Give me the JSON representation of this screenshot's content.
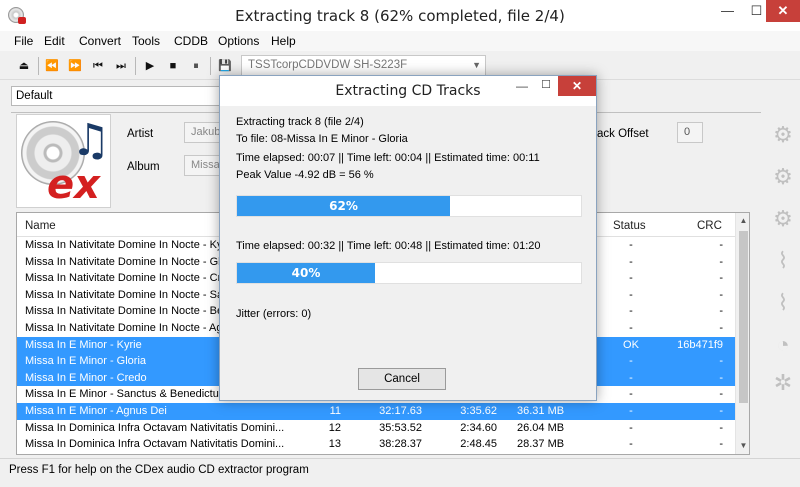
{
  "window": {
    "title": "Extracting track 8 (62% completed, file 2/4)",
    "min": "—",
    "max": "☐",
    "close": "✕"
  },
  "menu": [
    "File",
    "Edit",
    "Convert",
    "Tools",
    "CDDB",
    "Options",
    "Help"
  ],
  "toolbar": {
    "buttons": [
      "⏏",
      "⏪",
      "⏩",
      "⏮",
      "⏭",
      "▶",
      "■",
      "⏸",
      "💾"
    ],
    "drive": "TSSTcorpCDDVDW SH-S223F"
  },
  "profile": {
    "value": "Default"
  },
  "info": {
    "artist_label": "Artist",
    "artist_value": "Jakub",
    "album_label": "Album",
    "album_value": "Missae",
    "offset_label": "ack Offset",
    "offset_value": "0"
  },
  "table": {
    "headers": {
      "name": "Name",
      "status": "Status",
      "crc": "CRC"
    },
    "rows": [
      {
        "name": "Missa In Nativitate Domine In Nocte - Kyrie",
        "track": "",
        "start": "",
        "duration": "",
        "size": "",
        "status": "-",
        "crc": "-",
        "selected": false
      },
      {
        "name": "Missa In Nativitate Domine In Nocte - Gloria",
        "track": "",
        "start": "",
        "duration": "",
        "size": "",
        "status": "-",
        "crc": "-",
        "selected": false
      },
      {
        "name": "Missa In Nativitate Domine In Nocte - Credo",
        "track": "",
        "start": "",
        "duration": "",
        "size": "",
        "status": "-",
        "crc": "-",
        "selected": false
      },
      {
        "name": "Missa In Nativitate Domine In Nocte - Sanctus",
        "track": "",
        "start": "",
        "duration": "",
        "size": "",
        "status": "-",
        "crc": "-",
        "selected": false
      },
      {
        "name": "Missa In Nativitate Domine In Nocte - Benedictus",
        "track": "",
        "start": "",
        "duration": "",
        "size": "",
        "status": "-",
        "crc": "-",
        "selected": false
      },
      {
        "name": "Missa In Nativitate Domine In Nocte - Agnus Dei",
        "track": "",
        "start": "",
        "duration": "",
        "size": "",
        "status": "-",
        "crc": "-",
        "selected": false
      },
      {
        "name": "Missa In E Minor - Kyrie",
        "track": "",
        "start": "",
        "duration": "",
        "size": "",
        "status": "OK",
        "crc": "16b471f9",
        "selected": true
      },
      {
        "name": "Missa In E Minor - Gloria",
        "track": "",
        "start": "",
        "duration": "",
        "size": "",
        "status": "-",
        "crc": "-",
        "selected": true
      },
      {
        "name": "Missa In E Minor - Credo",
        "track": "",
        "start": "",
        "duration": "",
        "size": "",
        "status": "-",
        "crc": "-",
        "selected": true
      },
      {
        "name": "Missa In E Minor - Sanctus & Benedictus",
        "track": "",
        "start": "",
        "duration": "",
        "size": "",
        "status": "-",
        "crc": "-",
        "selected": false
      },
      {
        "name": "Missa In E Minor - Agnus Dei",
        "track": "11",
        "start": "32:17.63",
        "duration": "3:35.62",
        "size": "36.31 MB",
        "status": "-",
        "crc": "-",
        "selected": true
      },
      {
        "name": "Missa In Dominica Infra Octavam Nativitatis Domini...",
        "track": "12",
        "start": "35:53.52",
        "duration": "2:34.60",
        "size": "26.04 MB",
        "status": "-",
        "crc": "-",
        "selected": false
      },
      {
        "name": "Missa In Dominica Infra Octavam Nativitatis Domini...",
        "track": "13",
        "start": "38:28.37",
        "duration": "2:48.45",
        "size": "28.37 MB",
        "status": "-",
        "crc": "-",
        "selected": false
      }
    ]
  },
  "status_bar": "Press F1 for help on the CDex audio CD extractor program",
  "dialog": {
    "title": "Extracting CD Tracks",
    "line1": "Extracting track 8 (file 2/4)",
    "line2": "To file: 08-Missa In E Minor - Gloria",
    "line3": "Time elapsed: 00:07 || Time left: 00:04 || Estimated time: 00:11",
    "line4": "Peak Value -4.92 dB =  56 %",
    "progress1": {
      "label": "62%",
      "value": 62
    },
    "line5": "Time elapsed: 00:32 || Time left: 00:48 || Estimated time: 01:20",
    "progress2": {
      "label": "40%",
      "value": 40
    },
    "jitter": "Jitter (errors: 0)",
    "cancel": "Cancel",
    "min": "—",
    "max": "☐",
    "close": "✕"
  },
  "colors": {
    "selection": "#3399ff",
    "progress": "#3399ee",
    "close_button": "#c7403a"
  }
}
